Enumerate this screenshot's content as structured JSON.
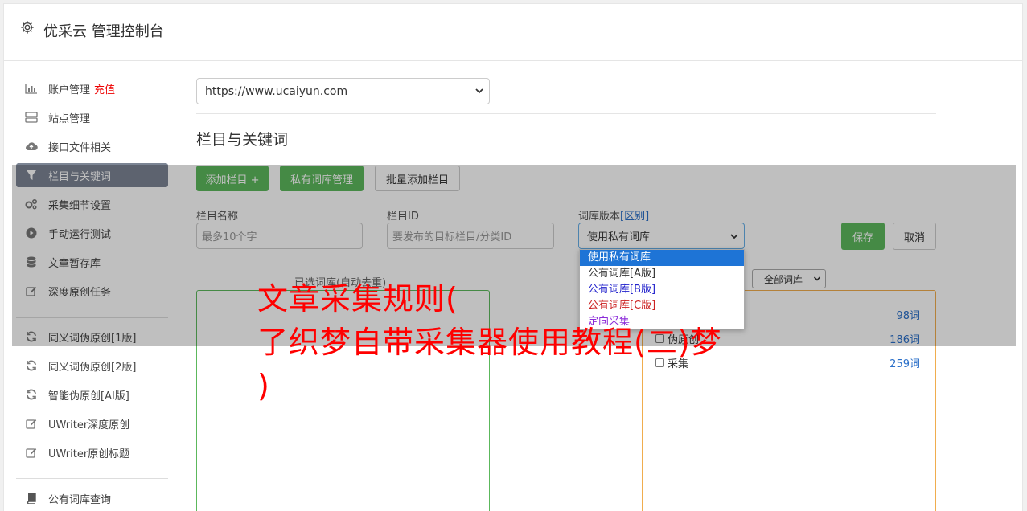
{
  "app": {
    "title": "优采云 管理控制台"
  },
  "sidebar": {
    "items": [
      {
        "label": "账户管理",
        "icon": "bar-chart-icon",
        "badge": "充值"
      },
      {
        "label": "站点管理",
        "icon": "server-icon"
      },
      {
        "label": "接口文件相关",
        "icon": "cloud-upload-icon"
      },
      {
        "label": "栏目与关键词",
        "icon": "filter-icon",
        "active": true
      },
      {
        "label": "采集细节设置",
        "icon": "gears-icon"
      },
      {
        "label": "手动运行测试",
        "icon": "play-circle-icon"
      },
      {
        "label": "文章暂存库",
        "icon": "database-icon"
      },
      {
        "label": "深度原创任务",
        "icon": "edit-icon"
      },
      {
        "label": "同义词伪原创[1版]",
        "icon": "refresh-icon"
      },
      {
        "label": "同义词伪原创[2版]",
        "icon": "refresh-icon"
      },
      {
        "label": "智能伪原创[AI版]",
        "icon": "refresh-icon"
      },
      {
        "label": "UWriter深度原创",
        "icon": "edit-icon"
      },
      {
        "label": "UWriter原创标题",
        "icon": "edit-icon"
      },
      {
        "label": "公有词库查询",
        "icon": "book-icon"
      }
    ]
  },
  "main": {
    "site_select": {
      "value": "https://www.ucaiyun.com"
    },
    "section_title": "栏目与关键词",
    "buttons": {
      "add_column": "添加栏目 +",
      "private_lexicon": "私有词库管理",
      "bulk_add": "批量添加栏目",
      "save": "保存",
      "cancel": "取消"
    },
    "form": {
      "column_name_label": "栏目名称",
      "column_name_placeholder": "最多10个字",
      "column_id_label": "栏目ID",
      "column_id_placeholder": "要发布的目标栏目/分类ID",
      "lexicon_version_label": "词库版本",
      "lexicon_version_link": "[区别]",
      "lexicon_version_value": "使用私有词库"
    },
    "dropdown_options": [
      "使用私有词库",
      "公有词库[A版]",
      "公有词库[B版]",
      "公有词库[C版]",
      "定向采集"
    ],
    "selected_lexicon_label": "已选词库(自动去重)",
    "lexicon_filter": "全部词库",
    "lexicon_rows": [
      {
        "label": "",
        "count": "98词"
      },
      {
        "label": "伪原创",
        "count": "186词"
      },
      {
        "label": "采集",
        "count": "259词"
      }
    ]
  },
  "watermark": {
    "lines": [
      "文章采集规则(",
      "了织梦自带采集器使用教程(二)梦",
      ")"
    ]
  },
  "colors": {
    "primary_green": "#5cb85c",
    "active_sidebar": "#7c8594",
    "link_blue": "#2a6fc9",
    "watermark_red": "#ff0000"
  }
}
